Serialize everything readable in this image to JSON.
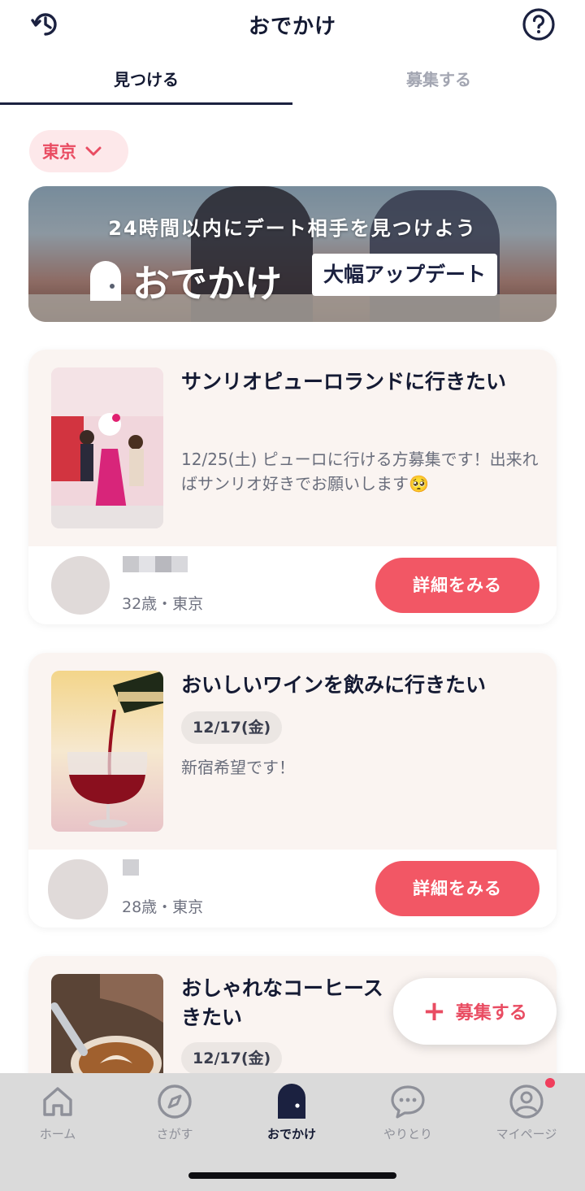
{
  "header": {
    "title": "おでかけ",
    "left_icon": "history-clock-icon",
    "right_icon": "help-question-icon"
  },
  "tabs": [
    {
      "label": "見つける",
      "active": true
    },
    {
      "label": "募集する",
      "active": false
    }
  ],
  "region_filter": {
    "label": "東京"
  },
  "banner": {
    "subtitle": "24時間以内にデート相手を見つけよう",
    "logo_text": "おでかけ",
    "badge": "大幅アップデート"
  },
  "posts": [
    {
      "title": "サンリオピューロランドに行きたい",
      "description": "12/25(土) ピューロに行ける方募集です！出来ればサンリオ好きでお願いします🥺",
      "user_meta": "32歳・東京",
      "button": "詳細をみる"
    },
    {
      "title": "おいしいワインを飲みに行きたい",
      "date": "12/17(金)",
      "description": "新宿希望です！",
      "user_meta": "28歳・東京",
      "button": "詳細をみる"
    },
    {
      "title": "おしゃれなコーヒース",
      "title_line2": "きたい",
      "date": "12/17(金)"
    }
  ],
  "fab": {
    "label": "募集する"
  },
  "bottom_nav": [
    {
      "label": "ホーム",
      "icon": "home-icon"
    },
    {
      "label": "さがす",
      "icon": "compass-icon"
    },
    {
      "label": "おでかけ",
      "icon": "door-icon",
      "active": true
    },
    {
      "label": "やりとり",
      "icon": "chat-bubble-icon"
    },
    {
      "label": "マイページ",
      "icon": "user-circle-icon",
      "badge": true
    }
  ],
  "colors": {
    "accent": "#f25765",
    "primary_text": "#141a33",
    "chip_bg": "#fde8ea",
    "card_bg": "#faf4f1"
  }
}
